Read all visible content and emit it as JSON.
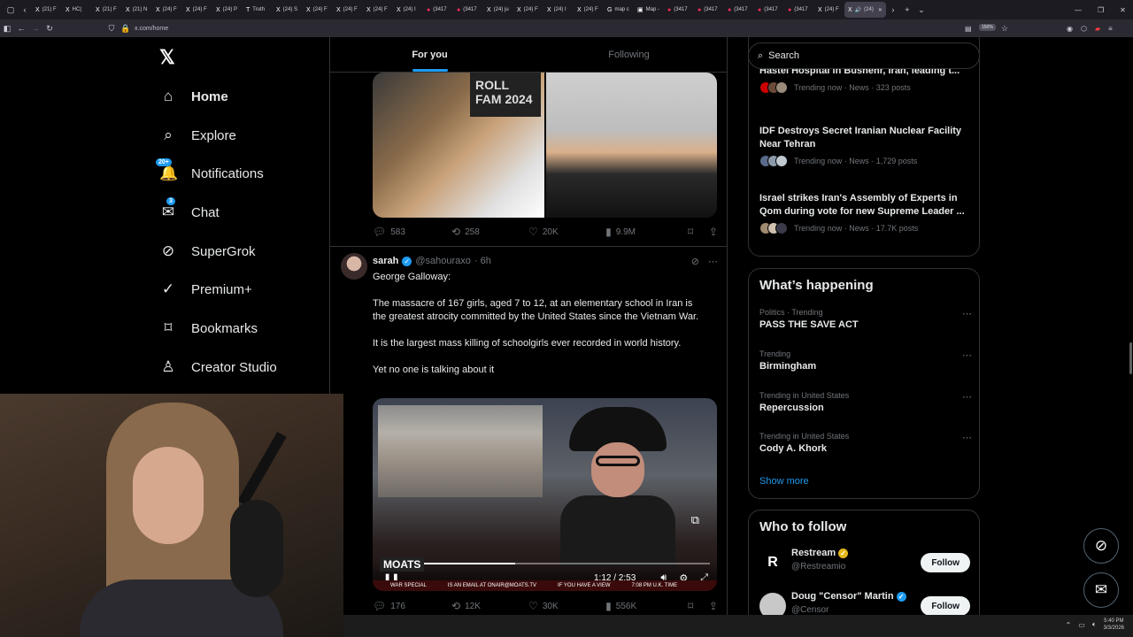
{
  "browser": {
    "tabs": [
      {
        "icon": "X",
        "label": "(21) F",
        "red": false
      },
      {
        "icon": "X",
        "label": "HC(",
        "red": false
      },
      {
        "icon": "X",
        "label": "(21) F",
        "red": false
      },
      {
        "icon": "X",
        "label": "(21) N",
        "red": false
      },
      {
        "icon": "X",
        "label": "(24) F",
        "red": false
      },
      {
        "icon": "X",
        "label": "(24) F",
        "red": false
      },
      {
        "icon": "X",
        "label": "(24) P",
        "red": false
      },
      {
        "icon": "T",
        "label": "Truth",
        "red": false
      },
      {
        "icon": "X",
        "label": "(24) S",
        "red": false
      },
      {
        "icon": "X",
        "label": "(24) F",
        "red": false
      },
      {
        "icon": "X",
        "label": "(24) F",
        "red": false
      },
      {
        "icon": "X",
        "label": "(24) F",
        "red": false
      },
      {
        "icon": "X",
        "label": "(24) I",
        "red": false
      },
      {
        "icon": "●",
        "label": "(3417",
        "red": true
      },
      {
        "icon": "●",
        "label": "(3417",
        "red": true
      },
      {
        "icon": "X",
        "label": "(24) ju",
        "red": false
      },
      {
        "icon": "X",
        "label": "(24) F",
        "red": false
      },
      {
        "icon": "X",
        "label": "(24) I",
        "red": false
      },
      {
        "icon": "X",
        "label": "(24) F",
        "red": false
      },
      {
        "icon": "G",
        "label": "map c",
        "red": false
      },
      {
        "icon": "▣",
        "label": "Map -",
        "red": false
      },
      {
        "icon": "●",
        "label": "(3417",
        "red": true
      },
      {
        "icon": "●",
        "label": "(3417",
        "red": true
      },
      {
        "icon": "●",
        "label": "(3417",
        "red": true
      },
      {
        "icon": "●",
        "label": "(3417",
        "red": true
      },
      {
        "icon": "●",
        "label": "(3417",
        "red": true
      },
      {
        "icon": "X",
        "label": "(24) F",
        "red": false
      }
    ],
    "active_tab": {
      "label": "(24)"
    },
    "url": "x.com/home",
    "zoom": "150%"
  },
  "nav": {
    "logo": "𝕏",
    "items": [
      {
        "label": "Home",
        "icon": "⌂",
        "active": true,
        "badge": ""
      },
      {
        "label": "Explore",
        "icon": "⌕",
        "active": false,
        "badge": ""
      },
      {
        "label": "Notifications",
        "icon": "🔔",
        "active": false,
        "badge": "20+"
      },
      {
        "label": "Chat",
        "icon": "✉",
        "active": false,
        "badge": "3"
      },
      {
        "label": "SuperGrok",
        "icon": "⊘",
        "active": false,
        "badge": ""
      },
      {
        "label": "Premium+",
        "icon": "✓",
        "active": false,
        "badge": ""
      },
      {
        "label": "Bookmarks",
        "icon": "⌑",
        "active": false,
        "badge": ""
      },
      {
        "label": "Creator Studio",
        "icon": "♙",
        "active": false,
        "badge": ""
      }
    ]
  },
  "feed": {
    "tabs": [
      "For you",
      "Following"
    ],
    "selected_tab": "For you",
    "top_post": {
      "image_text": "ROLL FAM 2024",
      "stats": {
        "replies": "583",
        "reposts": "258",
        "likes": "20K",
        "views": "9.9M"
      }
    },
    "post": {
      "name": "sarah",
      "handle": "@sahouraxo",
      "time": "· 6h",
      "paragraphs": [
        "George Galloway:",
        "The massacre of 167 girls, aged 7 to 12, at an elementary school in Iran is the greatest atrocity committed by the United States since the Vietnam War.",
        "It is the largest mass killing of schoolgirls ever recorded in world history.",
        "Yet no one is talking about it"
      ],
      "video": {
        "time": "1:12 / 2:53",
        "progress": 0.41,
        "logo": "MOATS",
        "ticker": [
          "WAR SPECIAL",
          "IS AN EMAIL AT ONAIR@MOATS.TV",
          "IF YOU HAVE A VIEW",
          "7:08 PM U.K. TIME"
        ]
      },
      "stats": {
        "replies": "176",
        "reposts": "12K",
        "likes": "30K",
        "views": "556K"
      }
    }
  },
  "sidebar": {
    "search_placeholder": "Search",
    "news": [
      {
        "title": "Hastei Hospital in Bushehr, Iran, leading t...",
        "meta": "Trending now · News · 323 posts",
        "avatars": [
          "#cc0000",
          "#6b4a3a",
          "#9a8a7a"
        ]
      },
      {
        "title": "IDF Destroys Secret Iranian Nuclear Facility Near Tehran",
        "meta": "Trending now · News · 1,729 posts",
        "avatars": [
          "#5a6a8a",
          "#8a9aaa",
          "#c0c8d0"
        ]
      },
      {
        "title": "Israel strikes Iran's Assembly of Experts in Qom during vote for new Supreme Leader ...",
        "meta": "Trending now · News · 17.7K posts",
        "avatars": [
          "#a08a70",
          "#d0c0b0",
          "#3a3a4a"
        ]
      }
    ],
    "whats_happening": {
      "title": "What’s happening",
      "trends": [
        {
          "context": "Politics · Trending",
          "name": "PASS THE SAVE ACT"
        },
        {
          "context": "Trending",
          "name": "Birmingham"
        },
        {
          "context": "Trending in United States",
          "name": "Repercussion"
        },
        {
          "context": "Trending in United States",
          "name": "Cody A. Khork"
        }
      ],
      "show_more": "Show more"
    },
    "who_to_follow": {
      "title": "Who to follow",
      "accounts": [
        {
          "name": "Restream",
          "handle": "@Restreamio",
          "avatar": "R",
          "button": "Follow"
        },
        {
          "name": "Doug \"Censor\" Martin",
          "handle": "@Censor",
          "avatar": "",
          "button": "Follow"
        }
      ]
    }
  },
  "taskbar": {
    "time": "5:40 PM",
    "date": "3/3/2026"
  }
}
